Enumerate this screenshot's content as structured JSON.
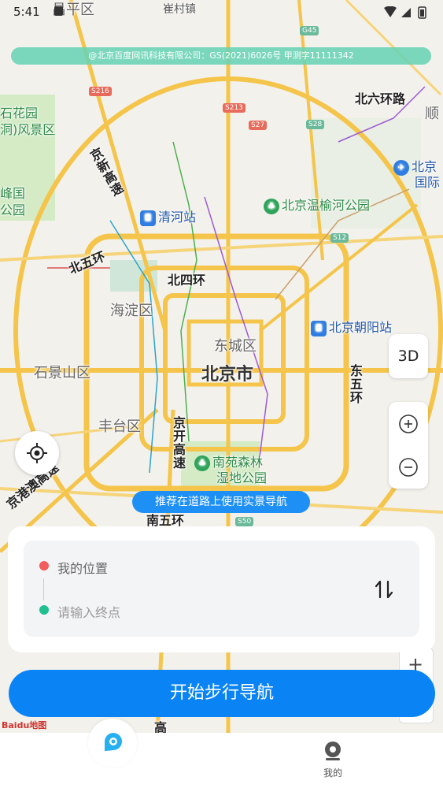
{
  "status_bar": {
    "time": "5:41"
  },
  "map": {
    "copyright": "@北京百度网讯科技有限公司：GS(2021)6026号 甲测字11111342",
    "labels": {
      "changping": "昌平区",
      "cuicun": "崔村镇",
      "beiliuhuan": "北六环路",
      "shun": "顺",
      "shihuayuan": "石花园",
      "fengjingqu": "洞)风景区",
      "jingxin": "京新高速",
      "qinghe": "清河站",
      "wenyuhe": "北京温榆河公园",
      "beijing_airport_1": "北京",
      "beijing_airport_2": "国际",
      "yiguo": "峰国",
      "gongyuan": "公园",
      "beiwuhuan": "北五环",
      "beisihuan": "北四环",
      "haidian": "海淀区",
      "chaoyangzhan": "北京朝阳站",
      "dongcheng": "东城区",
      "shijingshan": "石景山区",
      "beijingshi": "北京市",
      "dongwuhuan": "东五环",
      "fengtai": "丰台区",
      "jingkai": "京开高速",
      "nanyuan_1": "南苑森林",
      "nanyuan_2": "湿地公园",
      "jinggangao": "京港澳高速",
      "nanwuhuan": "南五环",
      "gao": "高"
    },
    "shields": [
      "G45",
      "S216",
      "S213",
      "S27",
      "S28",
      "S12",
      "S50"
    ]
  },
  "controls": {
    "btn_3d": "3D",
    "zoom_in_icon": "plus-icon",
    "zoom_out_icon": "minus-icon",
    "locate_icon": "locate-icon"
  },
  "recommend_tip": "推荐在道路上使用实景导航",
  "route": {
    "origin": "我的位置",
    "destination_placeholder": "请输入终点",
    "origin_color": "#f25c5c",
    "destination_color": "#1fbf8f"
  },
  "start_button": "开始步行导航",
  "baidu_logo": "Baidu地图",
  "bottom_nav": {
    "mine_label": "我的"
  },
  "colors": {
    "accent": "#0a84f5",
    "copyright_bg": "#64d2b4"
  }
}
